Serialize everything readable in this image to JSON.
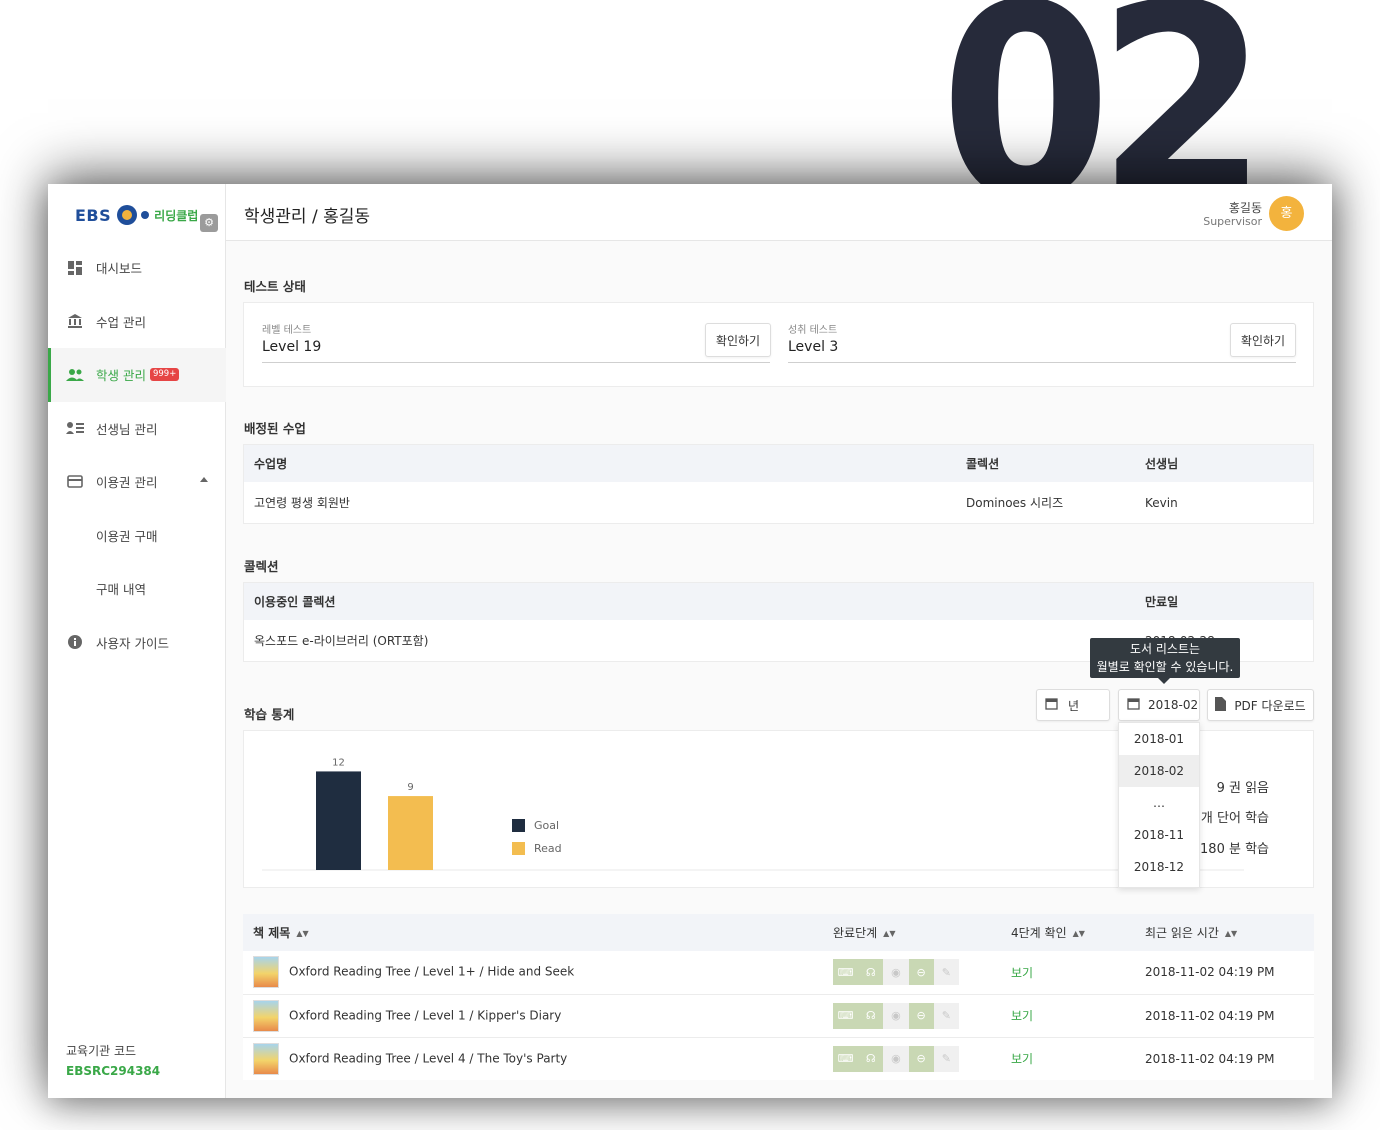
{
  "hero_number": "02",
  "sidebar": {
    "logo_ebs": "EBS",
    "logo_brand": "리딩클럽",
    "items": [
      {
        "label": "대시보드",
        "icon": "dashboard-icon"
      },
      {
        "label": "수업 관리",
        "icon": "bank-icon"
      },
      {
        "label": "학생 관리",
        "icon": "people-icon",
        "badge": "999+",
        "active": true
      },
      {
        "label": "선생님 관리",
        "icon": "teacher-list-icon"
      },
      {
        "label": "이용권 관리",
        "icon": "card-icon",
        "expanded": true
      },
      {
        "label": "이용권 구매",
        "sub": true
      },
      {
        "label": "구매 내역",
        "sub": true
      },
      {
        "label": "사용자 가이드",
        "icon": "info-icon"
      }
    ],
    "institution_label": "교육기관 코드",
    "institution_code": "EBSRC294384"
  },
  "header": {
    "title": "학생관리 / 홍길동",
    "user_name": "홍길동",
    "user_role": "Supervisor",
    "avatar": "홍"
  },
  "test_status": {
    "title": "테스트 상태",
    "level_label": "레벨 테스트",
    "level_value": "Level 19",
    "achievement_label": "성취 테스트",
    "achievement_value": "Level 3",
    "confirm_label": "확인하기"
  },
  "assigned_classes": {
    "title": "배정된 수업",
    "headers": [
      "수업명",
      "콜렉션",
      "선생님"
    ],
    "rows": [
      [
        "고연령 평생 회원반",
        "Dominoes 시리즈",
        "Kevin"
      ]
    ]
  },
  "collection": {
    "title": "콜렉션",
    "headers": [
      "이용중인 콜렉션",
      "만료일"
    ],
    "rows": [
      [
        "옥스포드 e-라이브러리 (ORT포함)",
        "2018-02-28"
      ]
    ]
  },
  "study_stats": {
    "title": "학습 통계",
    "year_button": "년",
    "month_button": "2018-02",
    "pdf_button": "PDF 다운로드",
    "tooltip_line1": "도서 리스트는",
    "tooltip_line2": "월별로 확인할 수 있습니다.",
    "dropdown": [
      "2018-01",
      "2018-02",
      "…",
      "2018-11",
      "2018-12"
    ],
    "dropdown_selected": "2018-02",
    "stat_books": "9 권 읽음",
    "stat_words": "415 개 단어 학습",
    "stat_minutes": "1,180 분 학습"
  },
  "chart_data": {
    "type": "bar",
    "categories": [
      "Goal",
      "Read"
    ],
    "values": [
      12,
      9
    ],
    "colors": [
      "#1f2d40",
      "#f3bd50"
    ],
    "legend": [
      "Goal",
      "Read"
    ],
    "legend_placement": "right",
    "ylim": [
      0,
      14
    ]
  },
  "books": {
    "headers": [
      "책 제목",
      "완료단계",
      "4단계 확인",
      "최근 읽은 시간"
    ],
    "view_label": "보기",
    "rows": [
      {
        "title": "Oxford Reading Tree / Level 1+ / Hide and Seek",
        "time": "2018-11-02 04:19 PM"
      },
      {
        "title": "Oxford Reading Tree / Level 1 / Kipper's Diary",
        "time": "2018-11-02 04:19 PM"
      },
      {
        "title": "Oxford Reading Tree / Level 4 / The Toy's Party",
        "time": "2018-11-02 04:19 PM"
      }
    ]
  }
}
